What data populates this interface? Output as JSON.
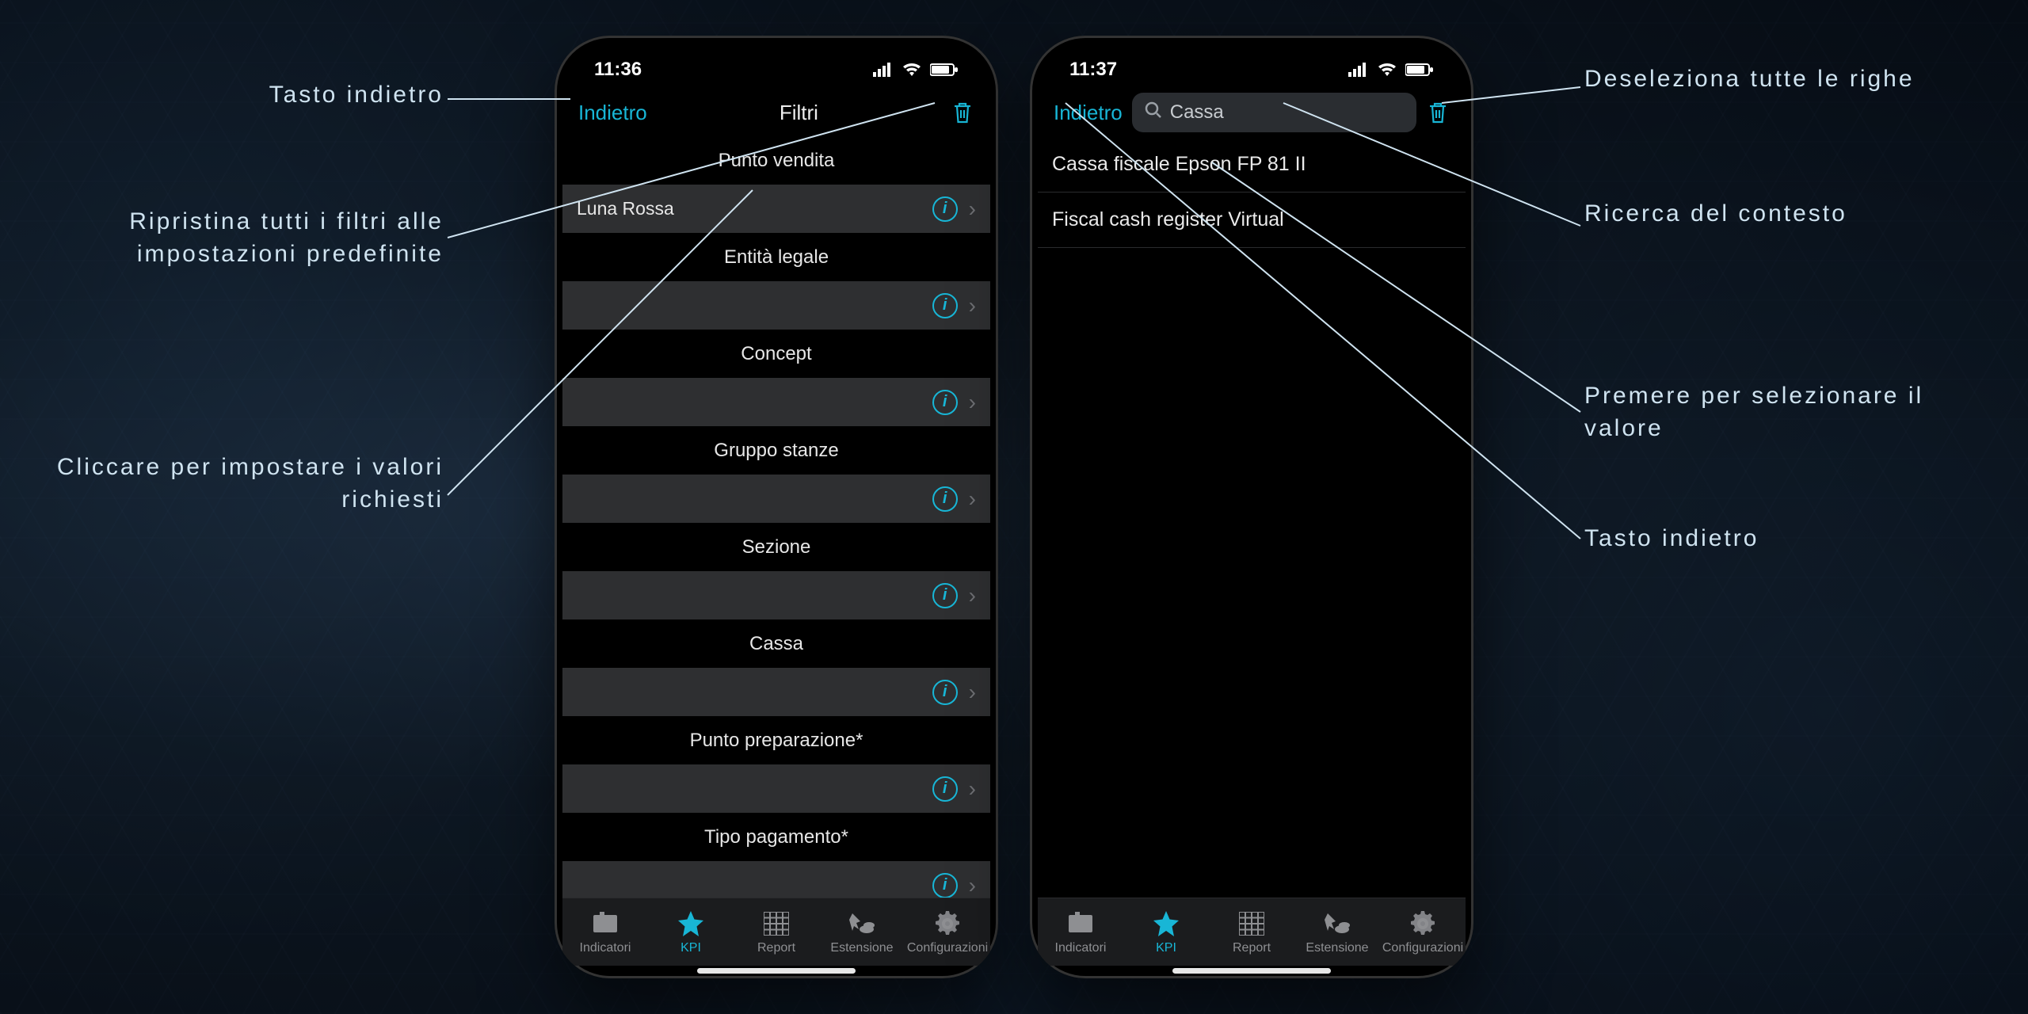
{
  "callouts": {
    "left": [
      {
        "text": "Tasto indietro"
      },
      {
        "text": "Ripristina tutti i filtri alle impostazioni predefinite"
      },
      {
        "text": "Cliccare per impostare i valori richiesti"
      }
    ],
    "right": [
      {
        "text": "Deseleziona tutte le righe"
      },
      {
        "text": "Ricerca del contesto"
      },
      {
        "text": "Premere per selezionare il valore"
      },
      {
        "text": "Tasto indietro"
      }
    ]
  },
  "left_phone": {
    "status_time": "11:36",
    "nav_back": "Indietro",
    "nav_title": "Filtri",
    "filters": [
      {
        "header": "Punto vendita",
        "value": "Luna Rossa"
      },
      {
        "header": "Entità legale",
        "value": ""
      },
      {
        "header": "Concept",
        "value": ""
      },
      {
        "header": "Gruppo stanze",
        "value": ""
      },
      {
        "header": "Sezione",
        "value": ""
      },
      {
        "header": "Cassa",
        "value": ""
      },
      {
        "header": "Punto preparazione*",
        "value": ""
      },
      {
        "header": "Tipo pagamento*",
        "value": ""
      }
    ]
  },
  "right_phone": {
    "status_time": "11:37",
    "nav_back": "Indietro",
    "search_text": "Cassa",
    "list": [
      "Cassa fiscale Epson FP 81 II",
      "Fiscal cash register Virtual"
    ]
  },
  "tabs": [
    {
      "label": "Indicatori"
    },
    {
      "label": "KPI"
    },
    {
      "label": "Report"
    },
    {
      "label": "Estensione"
    },
    {
      "label": "Configurazioni"
    }
  ],
  "colors": {
    "accent": "#18b6d6"
  }
}
